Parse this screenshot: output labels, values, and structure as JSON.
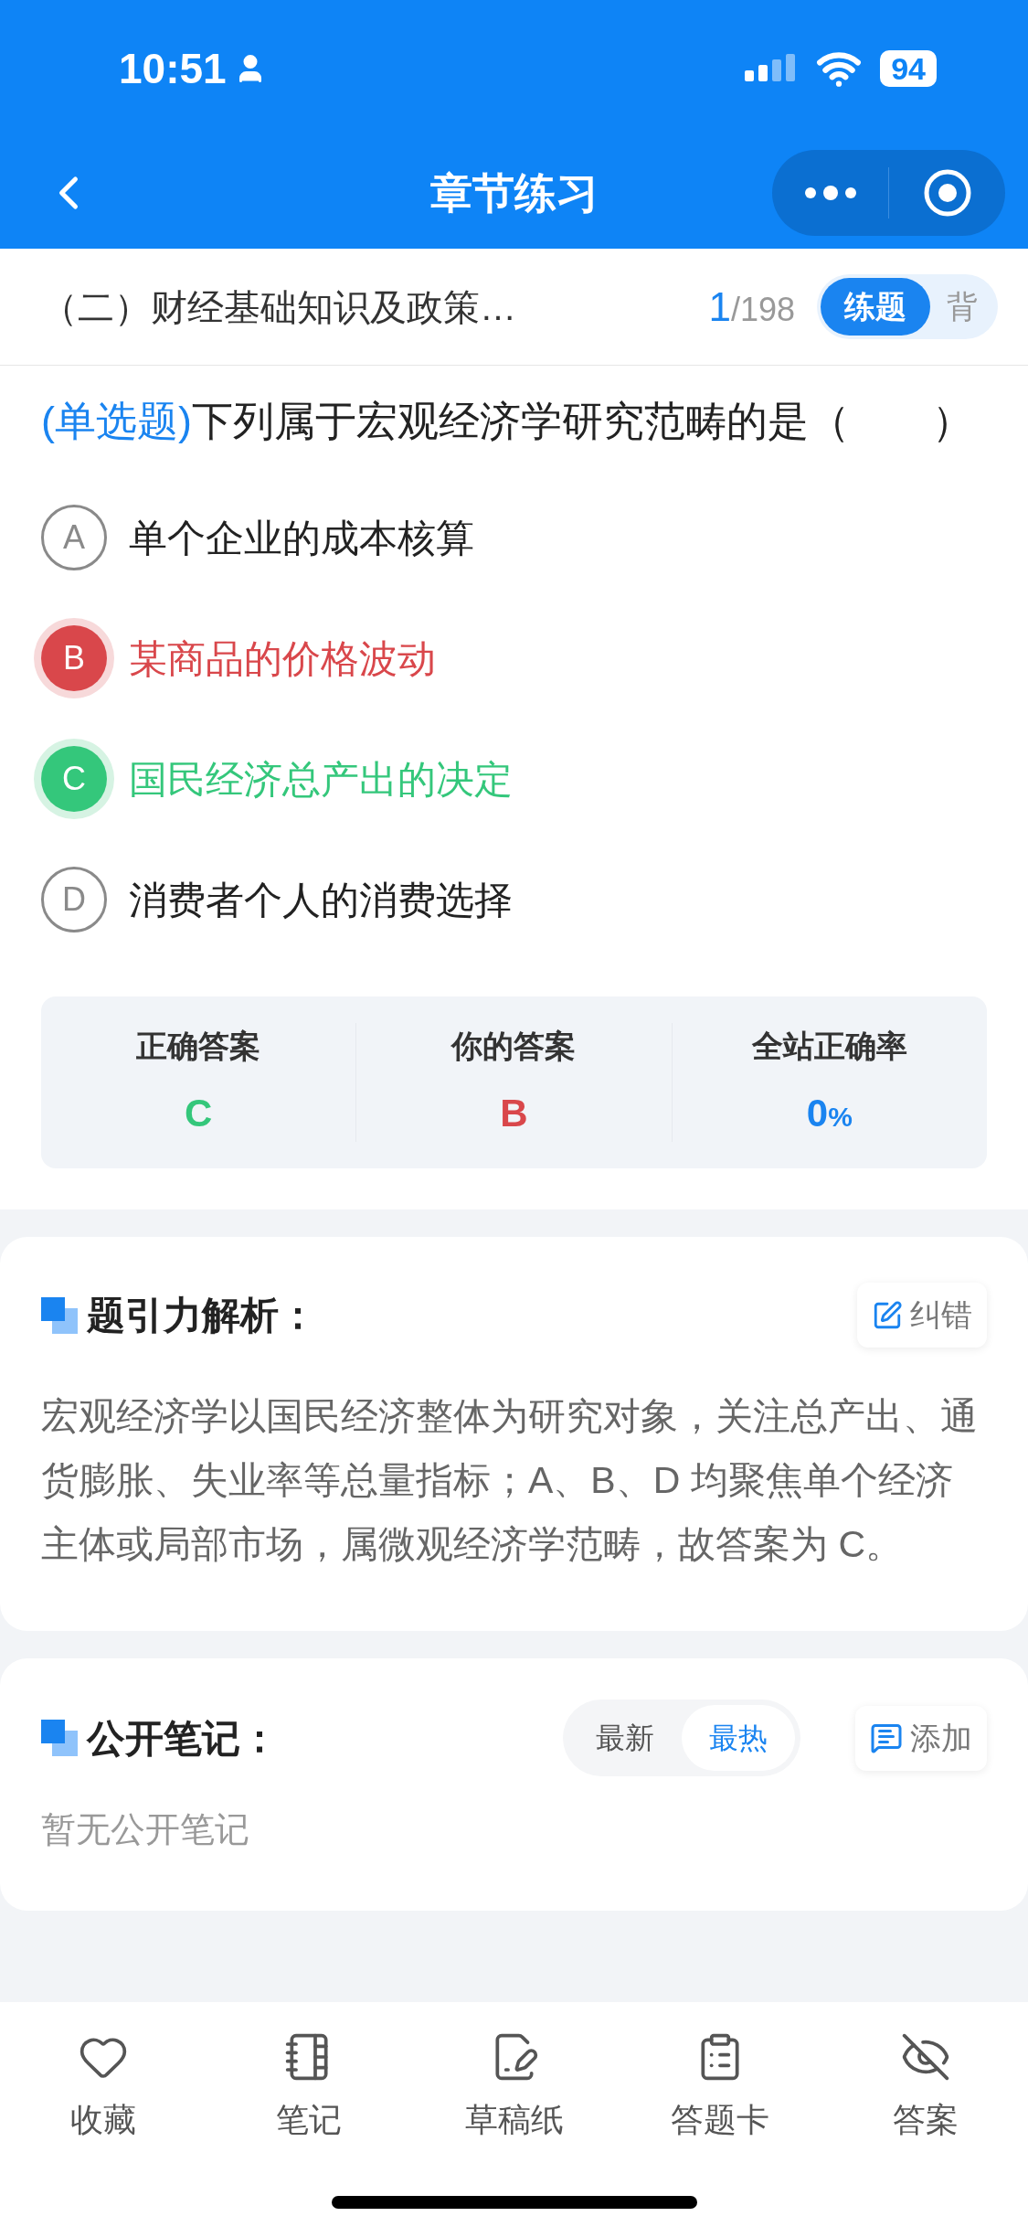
{
  "status_bar": {
    "time": "10:51",
    "battery": "94"
  },
  "nav": {
    "title": "章节练习"
  },
  "subheader": {
    "chapter": "（二）财经基础知识及政策…",
    "current": "1",
    "total": "/198",
    "modes": [
      {
        "label": "练题",
        "selected": true
      },
      {
        "label": "背",
        "selected": false
      }
    ]
  },
  "question": {
    "type": "(单选题)",
    "text": "下列属于宏观经济学研究范畴的是（　　）",
    "options": [
      {
        "letter": "A",
        "text": "单个企业的成本核算",
        "selected": false,
        "correct": false
      },
      {
        "letter": "B",
        "text": "某商品的价格波动",
        "selected": true,
        "correct": false
      },
      {
        "letter": "C",
        "text": "国民经济总产出的决定",
        "selected": false,
        "correct": true
      },
      {
        "letter": "D",
        "text": "消费者个人的消费选择",
        "selected": false,
        "correct": false
      }
    ]
  },
  "stats": [
    {
      "label": "正确答案",
      "value": "C",
      "color": "#34c77b"
    },
    {
      "label": "你的答案",
      "value": "B",
      "color": "#d9474b"
    },
    {
      "label": "全站正确率",
      "value": "0",
      "unit": "%",
      "color": "#1a84f0"
    }
  ],
  "analysis": {
    "title": "题引力解析：",
    "action": "纠错",
    "text": "宏观经济学以国民经济整体为研究对象，关注总产出、通货膨胀、失业率等总量指标；A、B、D 均聚焦单个经济主体或局部市场，属微观经济学范畴，故答案为 C。"
  },
  "notes": {
    "title": "公开笔记：",
    "sort": [
      {
        "label": "最新",
        "selected": false
      },
      {
        "label": "最热",
        "selected": true
      }
    ],
    "action": "添加",
    "empty": "暂无公开笔记"
  },
  "bottom_bar": [
    {
      "label": "收藏"
    },
    {
      "label": "笔记"
    },
    {
      "label": "草稿纸"
    },
    {
      "label": "答题卡"
    },
    {
      "label": "答案"
    }
  ]
}
